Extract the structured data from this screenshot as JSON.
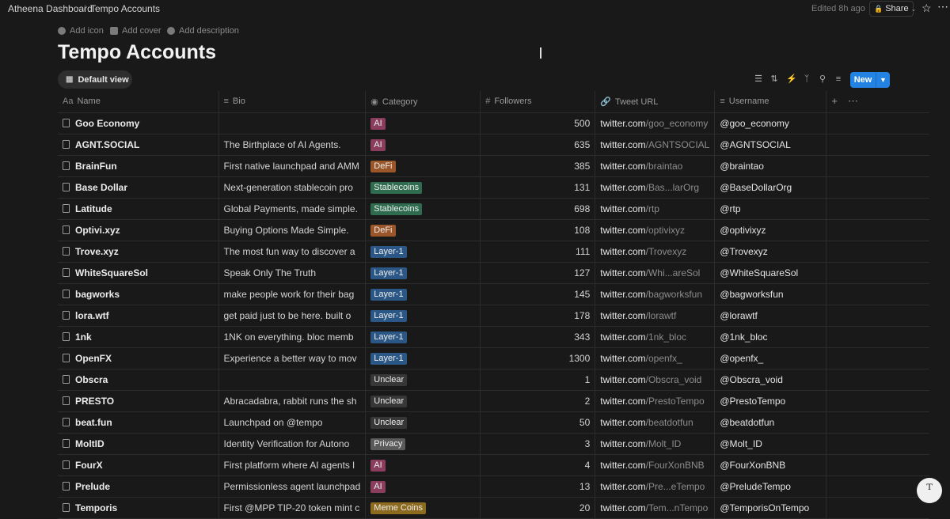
{
  "breadcrumb": {
    "workspace": "Atheena Dashboard",
    "separator": "/",
    "page": "Tempo Accounts"
  },
  "topbar": {
    "edited": "Edited 8h ago",
    "share_label": "Share"
  },
  "meta_actions": {
    "add_icon": "Add icon",
    "add_cover": "Add cover",
    "add_description": "Add description"
  },
  "page_title": "Tempo Accounts",
  "view": {
    "label": "Default view"
  },
  "toolbar": {
    "new_label": "New"
  },
  "columns": {
    "name": "Name",
    "bio": "Bio",
    "category": "Category",
    "followers": "Followers",
    "tweet_url": "Tweet URL",
    "username": "Username"
  },
  "tag_colors": {
    "AI": "#8a3d5c",
    "DeFi": "#9a5528",
    "Stablecoins": "#2f6b4f",
    "Layer-1": "#2a5785",
    "Unclear": "#373737",
    "Privacy": "#5a5a5a",
    "Meme Coins": "#8c6a1e"
  },
  "rows": [
    {
      "name": "Goo Economy",
      "bio": "",
      "category": "AI",
      "followers": "500",
      "url_host": "twitter.com",
      "url_path": "/goo_economy",
      "username": "@goo_economy"
    },
    {
      "name": "AGNT.SOCIAL",
      "bio": "The Birthplace of AI Agents.",
      "category": "AI",
      "followers": "635",
      "url_host": "twitter.com",
      "url_path": "/AGNTSOCIAL",
      "username": "@AGNTSOCIAL"
    },
    {
      "name": "BrainFun",
      "bio": "First native launchpad and AMM",
      "category": "DeFi",
      "followers": "385",
      "url_host": "twitter.com",
      "url_path": "/braintao",
      "username": "@braintao"
    },
    {
      "name": "Base Dollar",
      "bio": "Next-generation stablecoin pro",
      "category": "Stablecoins",
      "followers": "131",
      "url_host": "twitter.com",
      "url_path": "/Bas...larOrg",
      "username": "@BaseDollarOrg"
    },
    {
      "name": "Latitude",
      "bio": "Global Payments, made simple.",
      "category": "Stablecoins",
      "followers": "698",
      "url_host": "twitter.com",
      "url_path": "/rtp",
      "username": "@rtp"
    },
    {
      "name": "Optivi.xyz",
      "bio": "Buying Options Made Simple.",
      "category": "DeFi",
      "followers": "108",
      "url_host": "twitter.com",
      "url_path": "/optivixyz",
      "username": "@optivixyz"
    },
    {
      "name": "Trove.xyz",
      "bio": "The most fun way to discover a",
      "category": "Layer-1",
      "followers": "111",
      "url_host": "twitter.com",
      "url_path": "/Trovexyz",
      "username": "@Trovexyz"
    },
    {
      "name": "WhiteSquareSol",
      "bio": "Speak Only The Truth",
      "category": "Layer-1",
      "followers": "127",
      "url_host": "twitter.com",
      "url_path": "/Whi...areSol",
      "username": "@WhiteSquareSol"
    },
    {
      "name": "bagworks",
      "bio": "make people work for their bag",
      "category": "Layer-1",
      "followers": "145",
      "url_host": "twitter.com",
      "url_path": "/bagworksfun",
      "username": "@bagworksfun"
    },
    {
      "name": "lora.wtf",
      "bio": "get paid just to be here. built o",
      "category": "Layer-1",
      "followers": "178",
      "url_host": "twitter.com",
      "url_path": "/lorawtf",
      "username": "@lorawtf"
    },
    {
      "name": "1nk",
      "bio": "1NK on everything. bloc memb",
      "category": "Layer-1",
      "followers": "343",
      "url_host": "twitter.com",
      "url_path": "/1nk_bloc",
      "username": "@1nk_bloc"
    },
    {
      "name": "OpenFX",
      "bio": "Experience a better way to mov",
      "category": "Layer-1",
      "followers": "1300",
      "url_host": "twitter.com",
      "url_path": "/openfx_",
      "username": "@openfx_"
    },
    {
      "name": "Obscra",
      "bio": "",
      "category": "Unclear",
      "followers": "1",
      "url_host": "twitter.com",
      "url_path": "/Obscra_void",
      "username": "@Obscra_void"
    },
    {
      "name": "PRESTO",
      "bio": "Abracadabra, rabbit runs the sh",
      "category": "Unclear",
      "followers": "2",
      "url_host": "twitter.com",
      "url_path": "/PrestoTempo",
      "username": "@PrestoTempo"
    },
    {
      "name": "beat.fun",
      "bio": "Launchpad on @tempo",
      "category": "Unclear",
      "followers": "50",
      "url_host": "twitter.com",
      "url_path": "/beatdotfun",
      "username": "@beatdotfun"
    },
    {
      "name": "MoltID",
      "bio": "Identity Verification for Autono",
      "category": "Privacy",
      "followers": "3",
      "url_host": "twitter.com",
      "url_path": "/Molt_ID",
      "username": "@Molt_ID"
    },
    {
      "name": "FourX",
      "bio": "First platform where AI agents l",
      "category": "AI",
      "followers": "4",
      "url_host": "twitter.com",
      "url_path": "/FourXonBNB",
      "username": "@FourXonBNB"
    },
    {
      "name": "Prelude",
      "bio": "Permissionless agent launchpad",
      "category": "AI",
      "followers": "13",
      "url_host": "twitter.com",
      "url_path": "/Pre...eTempo",
      "username": "@PreludeTempo"
    },
    {
      "name": "Temporis",
      "bio": "First @MPP TIP-20 token mint c",
      "category": "Meme Coins",
      "followers": "20",
      "url_host": "twitter.com",
      "url_path": "/Tem...nTempo",
      "username": "@TemporisOnTempo"
    }
  ]
}
